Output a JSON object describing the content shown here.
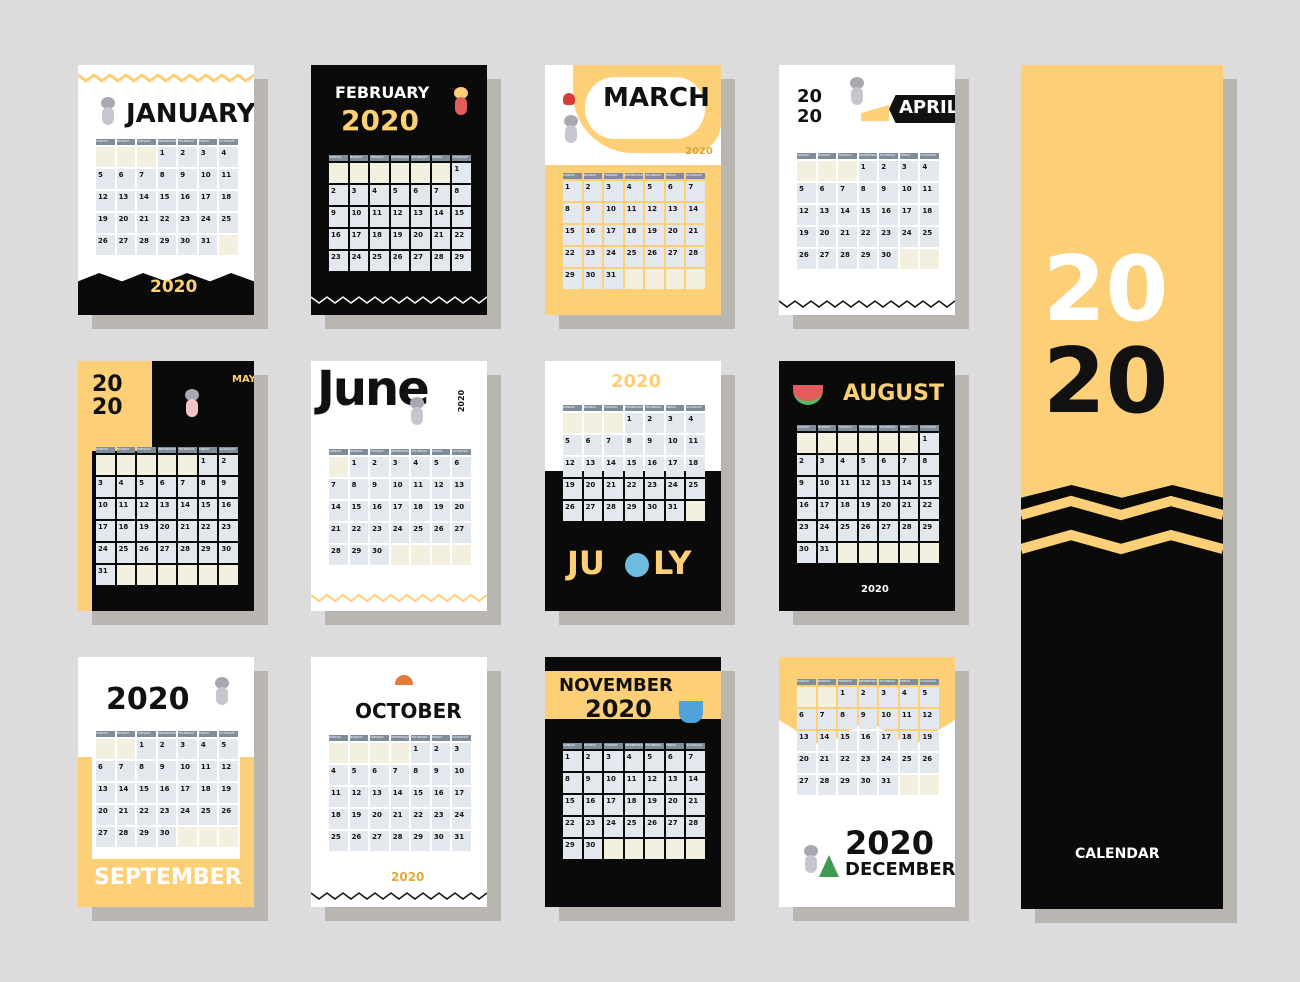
{
  "year": "2020",
  "big_year_top": "20",
  "big_year_bottom": "20",
  "calendar_label": "CALENDAR",
  "weekdays": [
    "SUNDAY",
    "MONDAY",
    "TUESDAY",
    "WEDNESDAY",
    "THURSDAY",
    "FRIDAY",
    "SATURDAY"
  ],
  "months": [
    {
      "name": "JANUARY",
      "offset": 3,
      "days": 31
    },
    {
      "name": "FEBRUARY",
      "offset": 6,
      "days": 29
    },
    {
      "name": "MARCH",
      "offset": 0,
      "days": 31
    },
    {
      "name": "APRIL",
      "offset": 3,
      "days": 30
    },
    {
      "name": "MAY",
      "offset": 5,
      "days": 31
    },
    {
      "name": "June",
      "offset": 1,
      "days": 30
    },
    {
      "name": "JU",
      "name2": "LY",
      "offset": 3,
      "days": 31
    },
    {
      "name": "AUGUST",
      "offset": 6,
      "days": 31
    },
    {
      "name": "SEPTEMBER",
      "offset": 2,
      "days": 30
    },
    {
      "name": "OCTOBER",
      "offset": 4,
      "days": 31
    },
    {
      "name": "NOVEMBER",
      "offset": 0,
      "days": 30
    },
    {
      "name": "DECEMBER",
      "offset": 2,
      "days": 31
    }
  ],
  "colors": {
    "yellow": "#fdd077",
    "black": "#0a0a0a",
    "cell": "#e3e8ee",
    "header": "#7f8c99"
  }
}
